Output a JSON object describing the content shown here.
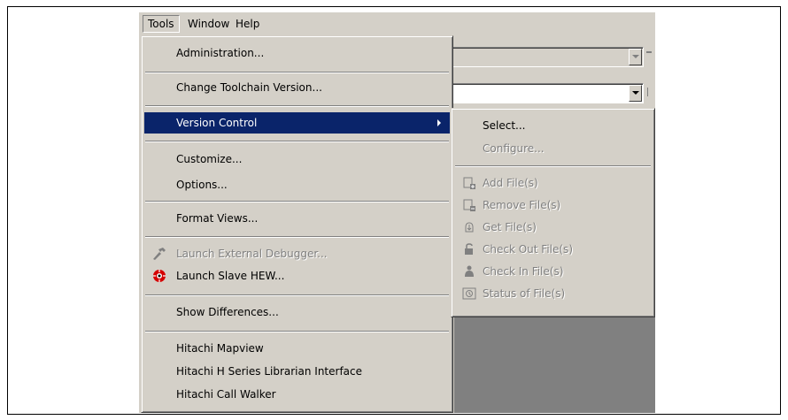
{
  "menubar": {
    "tools": "Tools",
    "window": "Window",
    "help": "Help"
  },
  "tools_menu": {
    "administration": "Administration...",
    "change_toolchain": "Change Toolchain Version...",
    "version_control": "Version Control",
    "customize": "Customize...",
    "options": "Options...",
    "format_views": "Format Views...",
    "launch_external_debugger": "Launch External Debugger...",
    "launch_slave_hew": "Launch Slave HEW...",
    "show_differences": "Show Differences...",
    "hitachi_mapview": "Hitachi Mapview",
    "hitachi_librarian": "Hitachi H Series Librarian Interface",
    "hitachi_call_walker": "Hitachi Call Walker"
  },
  "version_control_submenu": {
    "select": "Select...",
    "configure": "Configure...",
    "add_files": "Add File(s)",
    "remove_files": "Remove File(s)",
    "get_files": "Get File(s)",
    "check_out_files": "Check Out File(s)",
    "check_in_files": "Check In File(s)",
    "status_of_files": "Status of File(s)"
  },
  "colors": {
    "face": "#d4d0c8",
    "highlight": "#0a246a",
    "disabled_text": "#808080",
    "dark_area": "#808080"
  },
  "icons": {
    "launch_external_debugger": "hammer-icon",
    "launch_slave_hew": "hew-logo-icon",
    "add_files": "add-file-icon",
    "remove_files": "remove-file-icon",
    "get_files": "get-file-icon",
    "check_out_files": "check-out-icon",
    "check_in_files": "check-in-icon",
    "status_of_files": "status-icon"
  }
}
